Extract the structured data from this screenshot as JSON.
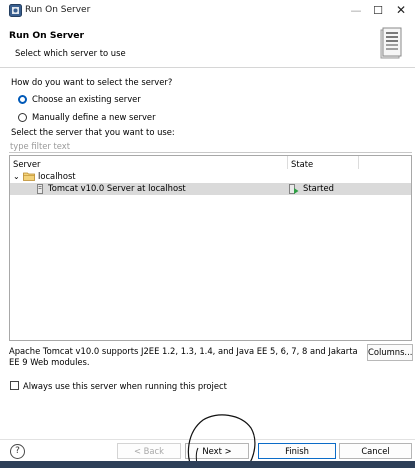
{
  "window": {
    "title": "Run On Server",
    "minimize_glyph": "—",
    "maximize_glyph": "☐",
    "close_glyph": "✕"
  },
  "header": {
    "title": "Run On Server",
    "description": "Select which server to use"
  },
  "question": "How do you want to select the server?",
  "options": [
    {
      "label": "Choose an existing server",
      "selected": true
    },
    {
      "label": "Manually define a new server",
      "selected": false
    }
  ],
  "select_label": "Select the server that you want to use:",
  "filter": {
    "placeholder": "type filter text",
    "value": ""
  },
  "table": {
    "columns": [
      "Server",
      "State"
    ],
    "group": {
      "label": "localhost",
      "expanded": true,
      "chevron": "⌄"
    },
    "rows": [
      {
        "server": "Tomcat v10.0 Server at localhost",
        "state": "Started",
        "selected": true
      }
    ]
  },
  "server_description": "Apache Tomcat v10.0 supports J2EE 1.2, 1.3, 1.4, and Java EE 5, 6, 7, 8 and Jakarta EE 9 Web modules.",
  "columns_button": "Columns...",
  "always_use": {
    "label": "Always use this server when running this project",
    "checked": false
  },
  "footer": {
    "help": "?",
    "back": "< Back",
    "next": "Next >",
    "finish": "Finish",
    "cancel": "Cancel"
  },
  "colors": {
    "accent": "#0b6bc7",
    "radio_selected": "#0059b8",
    "selection_bg": "#dadada",
    "folder": "#e8b94a",
    "started_green": "#2e9e44"
  },
  "icons": {
    "app": "server-app-icon",
    "banner": "server-wizard-banner-icon",
    "folder": "folder-icon",
    "server": "server-icon",
    "started": "started-icon"
  }
}
